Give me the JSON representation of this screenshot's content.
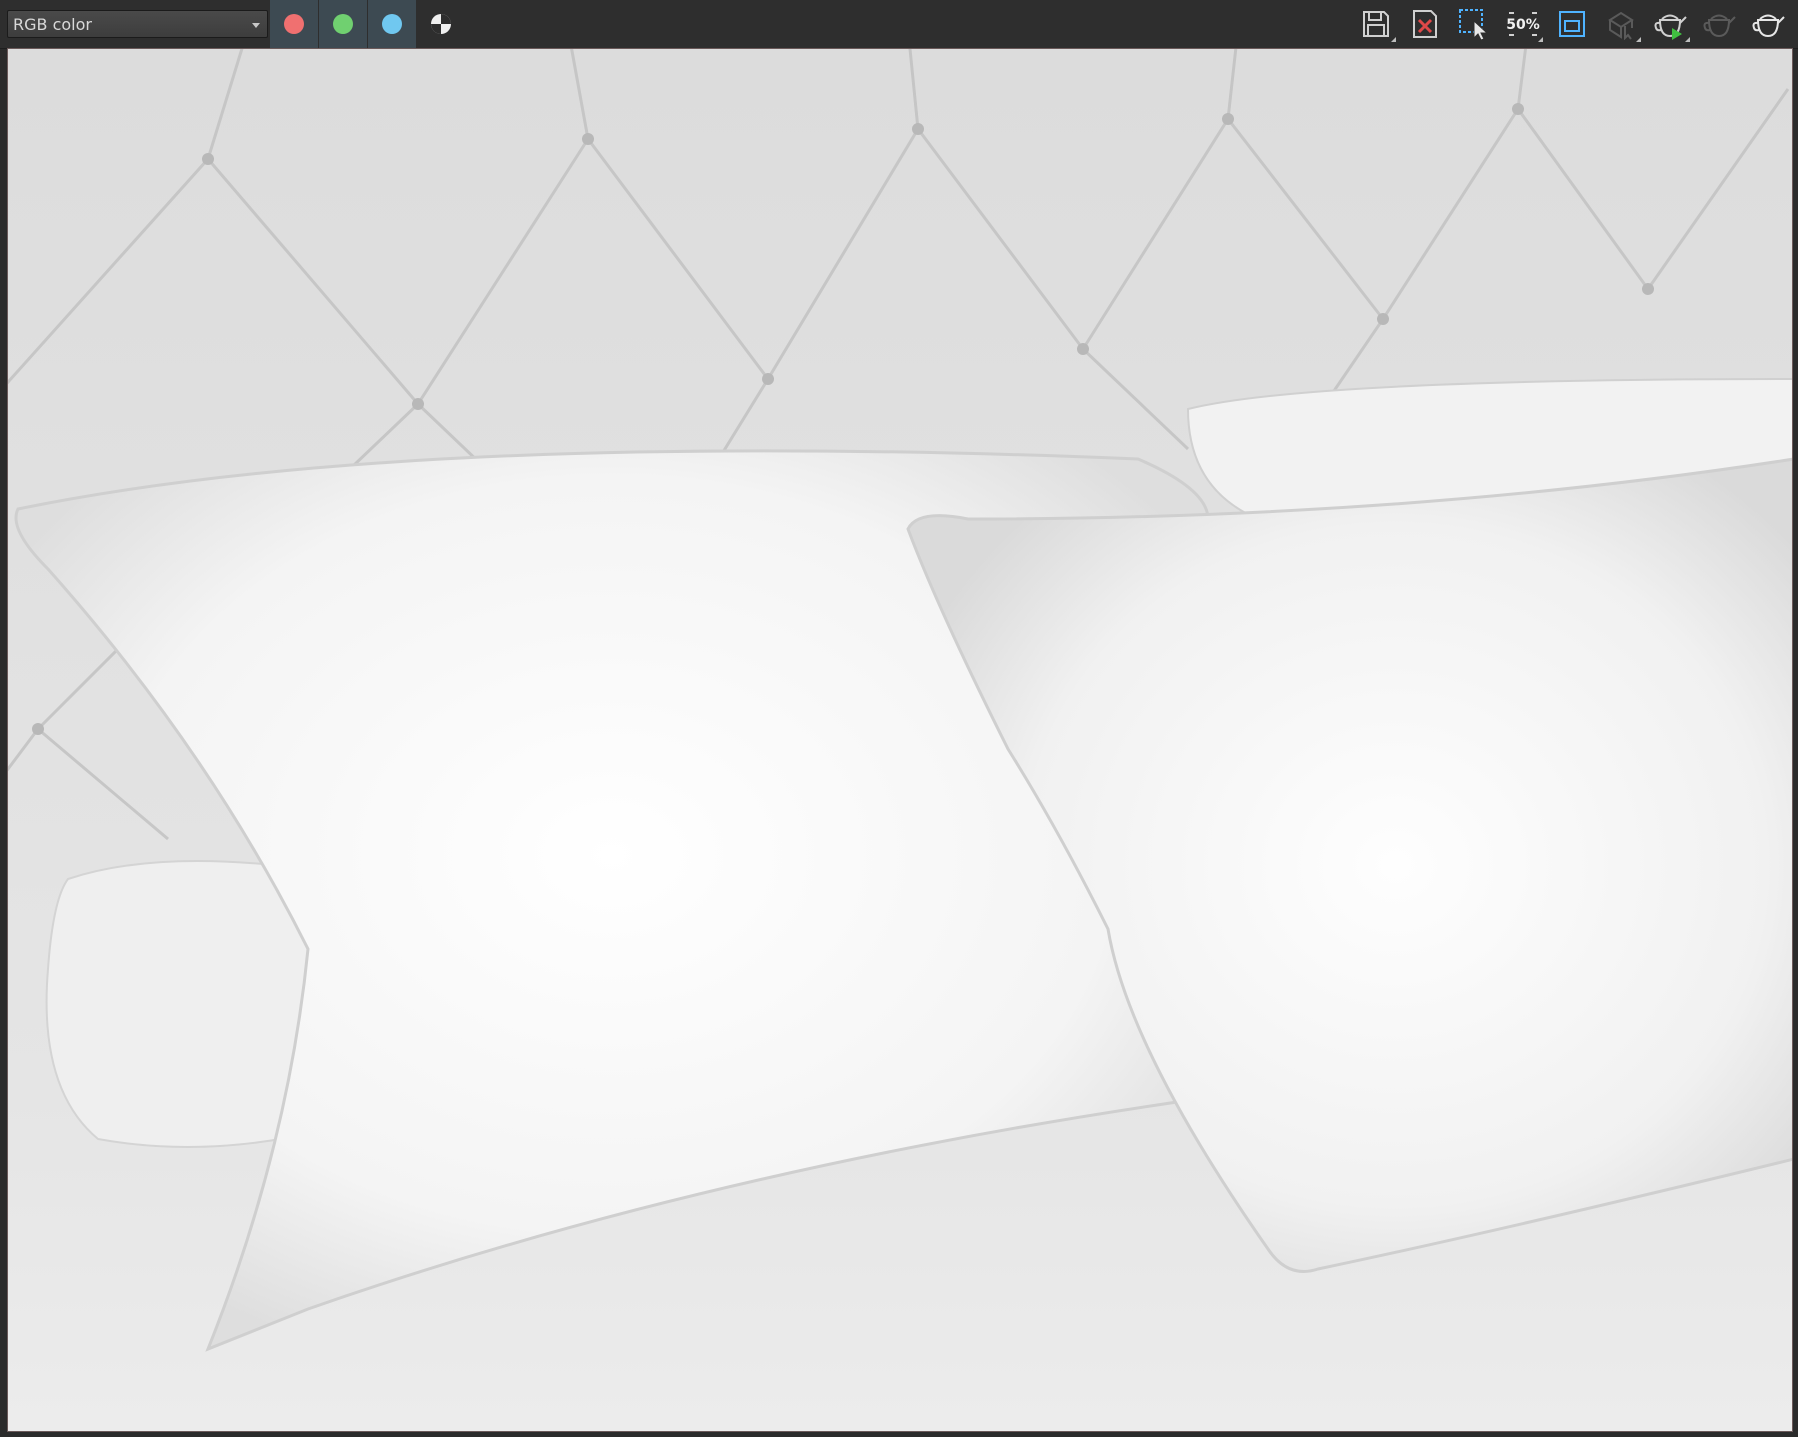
{
  "toolbar": {
    "channel_select": {
      "value": "RGB color"
    },
    "channels": [
      {
        "name": "red-channel-icon",
        "color": "#f07070",
        "active": true
      },
      {
        "name": "green-channel-icon",
        "color": "#70d070",
        "active": true
      },
      {
        "name": "blue-channel-icon",
        "color": "#70c8f0",
        "active": true
      }
    ],
    "zoom_label": "50%",
    "colors": {
      "accent": "#4fb3ff",
      "alpha_icon": "#f0f0f0",
      "icon": "#d0d0d0",
      "icon_disabled": "#5a5a5a",
      "close_red": "#e04848",
      "render_green": "#40c040"
    }
  }
}
